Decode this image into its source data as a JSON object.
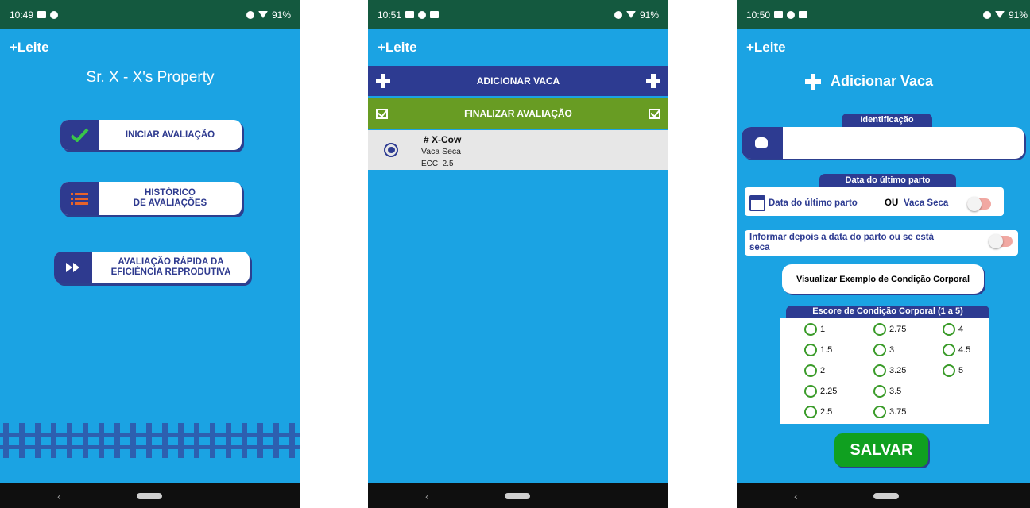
{
  "screen1": {
    "status": {
      "time": "10:49",
      "battery": "91%"
    },
    "app_title": "+Leite",
    "property_title": "Sr. X - X's Property",
    "buttons": {
      "start": "INICIAR AVALIAÇÃO",
      "history_line1": "HISTÓRICO",
      "history_line2": "DE AVALIAÇÕES",
      "quick_line1": "AVALIAÇÃO RÁPIDA DA",
      "quick_line2": "EFICIÊNCIA REPRODUTIVA"
    }
  },
  "screen2": {
    "status": {
      "time": "10:51",
      "battery": "91%"
    },
    "app_title": "+Leite",
    "add_cow": "ADICIONAR VACA",
    "finish": "FINALIZAR AVALIAÇÃO",
    "cow": {
      "name": "# X-Cow",
      "state": "Vaca Seca",
      "ecc": "ECC: 2.5"
    }
  },
  "screen3": {
    "status": {
      "time": "10:50",
      "battery": "91%"
    },
    "app_title": "+Leite",
    "heading": "Adicionar Vaca",
    "id_label": "Identificação",
    "id_value": "",
    "birth_label": "Data do último parto",
    "birth_row_label": "Data do último parto",
    "or_label": "OU",
    "dry_label": "Vaca Seca",
    "later_label": "Informar depois a data do parto ou se está seca",
    "example_button": "Visualizar Exemplo de Condição Corporal",
    "ecc_label": "Escore de Condição Corporal (1 a 5)",
    "ecc_options": [
      "1",
      "1.5",
      "2",
      "2.25",
      "2.5",
      "2.75",
      "3",
      "3.25",
      "3.5",
      "3.75",
      "4",
      "4.5",
      "5"
    ],
    "save_button": "SALVAR"
  },
  "colors": {
    "primary": "#1ba3e3",
    "navy": "#2d3b91",
    "green_bar": "#689c23",
    "save": "#10a020",
    "status_bar": "#14593f"
  }
}
